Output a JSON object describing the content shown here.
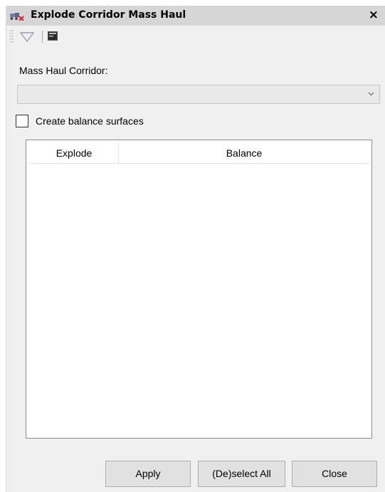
{
  "window": {
    "title": "Explode Corridor Mass Haul",
    "close_glyph": "×"
  },
  "toolbar": {
    "icons": [
      "filter-icon",
      "console-icon"
    ]
  },
  "form": {
    "corridor_label": "Mass Haul Corridor:",
    "corridor_value": "",
    "balance_checkbox_label": "Create balance surfaces",
    "balance_checked": false
  },
  "table": {
    "columns": [
      "Explode",
      "Balance"
    ],
    "rows": []
  },
  "buttons": {
    "apply": "Apply",
    "deselect_all": "(De)select All",
    "close": "Close"
  }
}
